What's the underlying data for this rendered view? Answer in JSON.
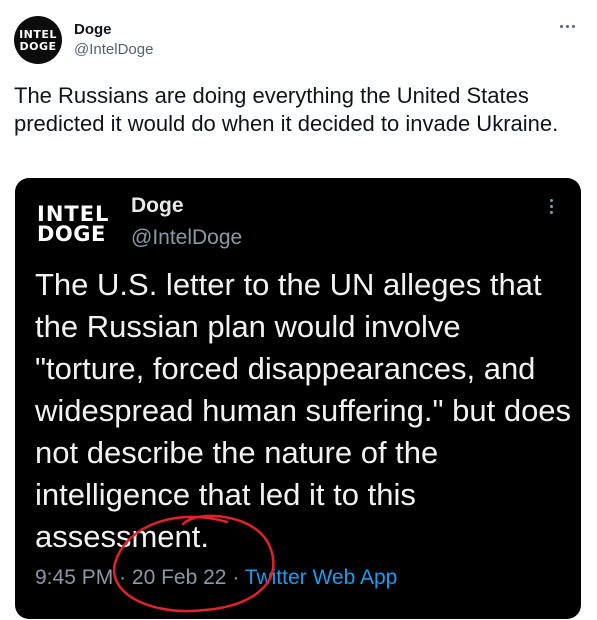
{
  "tweet": {
    "avatar": {
      "line1": "INTEL",
      "line2": "DOGE"
    },
    "display_name": "Doge",
    "handle": "@IntelDoge",
    "text": "The Russians are doing everything the United States predicted it would do when it decided to invade Ukraine."
  },
  "media": {
    "avatar": {
      "line1": "INTEL",
      "line2": "DOGE"
    },
    "display_name": "Doge",
    "handle": "@IntelDoge",
    "text": "The U.S. letter to the UN alleges that the Russian plan would involve \"torture, forced disappearances, and widespread human suffering.\" but does not describe the nature of the intelligence that led it to this assessment.",
    "time": "9:45 PM",
    "separator": "·",
    "date": "20 Feb 22",
    "source": "Twitter Web App"
  },
  "colors": {
    "annotation_circle": "#e0232b",
    "link": "#1d9bf0"
  }
}
